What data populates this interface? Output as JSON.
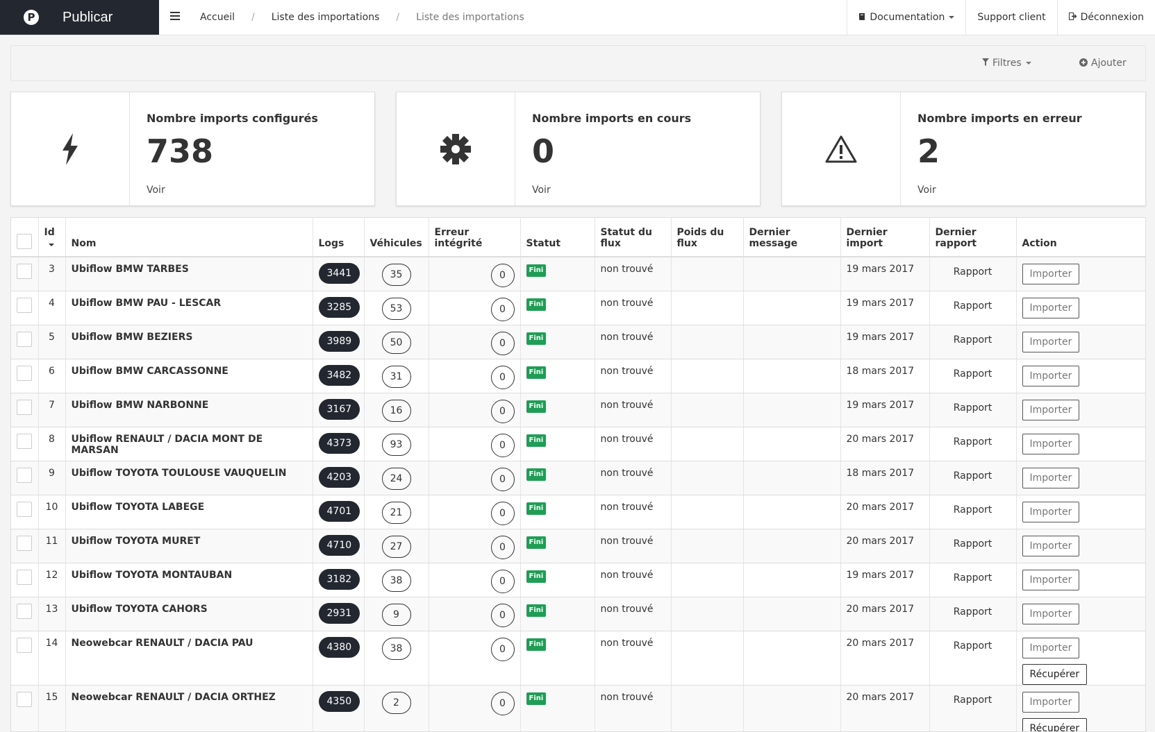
{
  "brand": {
    "logo_letter": "P",
    "name": "Publicar"
  },
  "breadcrumb": [
    "Accueil",
    "Liste des importations",
    "Liste des importations"
  ],
  "topnav": {
    "documentation": "Documentation",
    "support": "Support client",
    "logout": "Déconnexion"
  },
  "filterbar": {
    "filters": "Filtres",
    "add": "Ajouter"
  },
  "cards": [
    {
      "title": "Nombre imports configurés",
      "value": "738",
      "link": "Voir",
      "icon": "bolt-icon"
    },
    {
      "title": "Nombre imports en cours",
      "value": "0",
      "link": "Voir",
      "icon": "gear-icon"
    },
    {
      "title": "Nombre imports en erreur",
      "value": "2",
      "link": "Voir",
      "icon": "warning-icon"
    }
  ],
  "table": {
    "headers": {
      "id": "Id",
      "nom": "Nom",
      "logs": "Logs",
      "vehicules": "Véhicules",
      "erreur": "Erreur intégrité",
      "statut": "Statut",
      "statut_flux_1": "Statut du",
      "statut_flux_2": "flux",
      "poids_flux_1": "Poids du",
      "poids_flux_2": "flux",
      "dernier_message": "Dernier message",
      "dernier_import": "Dernier import",
      "dernier_rapport_1": "Dernier",
      "dernier_rapport_2": "rapport",
      "action": "Action"
    },
    "rows": [
      {
        "id": "3",
        "name": "Ubiflow BMW TARBES",
        "logs": "3441",
        "vehicules": "35",
        "erreur": "0",
        "statut": "Fini",
        "statut_flux": "non trouvé",
        "dernier_import": "19 mars 2017",
        "rapport": "Rapport",
        "importer": "Importer"
      },
      {
        "id": "4",
        "name": "Ubiflow BMW PAU - LESCAR",
        "logs": "3285",
        "vehicules": "53",
        "erreur": "0",
        "statut": "Fini",
        "statut_flux": "non trouvé",
        "dernier_import": "19 mars 2017",
        "rapport": "Rapport",
        "importer": "Importer"
      },
      {
        "id": "5",
        "name": "Ubiflow BMW BEZIERS",
        "logs": "3989",
        "vehicules": "50",
        "erreur": "0",
        "statut": "Fini",
        "statut_flux": "non trouvé",
        "dernier_import": "19 mars 2017",
        "rapport": "Rapport",
        "importer": "Importer"
      },
      {
        "id": "6",
        "name": "Ubiflow BMW CARCASSONNE",
        "logs": "3482",
        "vehicules": "31",
        "erreur": "0",
        "statut": "Fini",
        "statut_flux": "non trouvé",
        "dernier_import": "18 mars 2017",
        "rapport": "Rapport",
        "importer": "Importer"
      },
      {
        "id": "7",
        "name": "Ubiflow BMW NARBONNE",
        "logs": "3167",
        "vehicules": "16",
        "erreur": "0",
        "statut": "Fini",
        "statut_flux": "non trouvé",
        "dernier_import": "19 mars 2017",
        "rapport": "Rapport",
        "importer": "Importer"
      },
      {
        "id": "8",
        "name": "Ubiflow RENAULT / DACIA MONT DE MARSAN",
        "logs": "4373",
        "vehicules": "93",
        "erreur": "0",
        "statut": "Fini",
        "statut_flux": "non trouvé",
        "dernier_import": "20 mars 2017",
        "rapport": "Rapport",
        "importer": "Importer"
      },
      {
        "id": "9",
        "name": "Ubiflow TOYOTA TOULOUSE VAUQUELIN",
        "logs": "4203",
        "vehicules": "24",
        "erreur": "0",
        "statut": "Fini",
        "statut_flux": "non trouvé",
        "dernier_import": "18 mars 2017",
        "rapport": "Rapport",
        "importer": "Importer"
      },
      {
        "id": "10",
        "name": "Ubiflow TOYOTA LABEGE",
        "logs": "4701",
        "vehicules": "21",
        "erreur": "0",
        "statut": "Fini",
        "statut_flux": "non trouvé",
        "dernier_import": "20 mars 2017",
        "rapport": "Rapport",
        "importer": "Importer"
      },
      {
        "id": "11",
        "name": "Ubiflow TOYOTA MURET",
        "logs": "4710",
        "vehicules": "27",
        "erreur": "0",
        "statut": "Fini",
        "statut_flux": "non trouvé",
        "dernier_import": "20 mars 2017",
        "rapport": "Rapport",
        "importer": "Importer"
      },
      {
        "id": "12",
        "name": "Ubiflow TOYOTA MONTAUBAN",
        "logs": "3182",
        "vehicules": "38",
        "erreur": "0",
        "statut": "Fini",
        "statut_flux": "non trouvé",
        "dernier_import": "19 mars 2017",
        "rapport": "Rapport",
        "importer": "Importer"
      },
      {
        "id": "13",
        "name": "Ubiflow TOYOTA CAHORS",
        "logs": "2931",
        "vehicules": "9",
        "erreur": "0",
        "statut": "Fini",
        "statut_flux": "non trouvé",
        "dernier_import": "20 mars 2017",
        "rapport": "Rapport",
        "importer": "Importer"
      },
      {
        "id": "14",
        "name": "Neowebcar RENAULT / DACIA PAU",
        "logs": "4380",
        "vehicules": "38",
        "erreur": "0",
        "statut": "Fini",
        "statut_flux": "non trouvé",
        "dernier_import": "20 mars 2017",
        "rapport": "Rapport",
        "importer": "Importer",
        "recuperer": "Récupérer"
      },
      {
        "id": "15",
        "name": "Neowebcar RENAULT / DACIA ORTHEZ",
        "logs": "4350",
        "vehicules": "2",
        "erreur": "0",
        "statut": "Fini",
        "statut_flux": "non trouvé",
        "dernier_import": "20 mars 2017",
        "rapport": "Rapport",
        "importer": "Importer",
        "recuperer": "Récupérer"
      }
    ]
  }
}
